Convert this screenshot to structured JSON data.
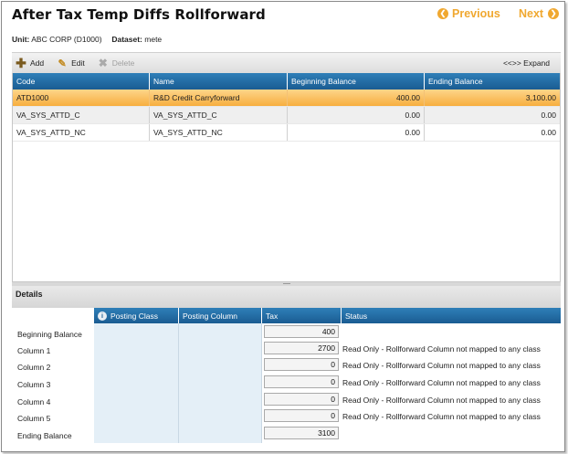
{
  "header": {
    "title": "After Tax Temp Diffs Rollforward",
    "previous_label": "Previous",
    "next_label": "Next"
  },
  "context": {
    "unit_label": "Unit:",
    "unit_value": "ABC CORP (D1000)",
    "dataset_label": "Dataset:",
    "dataset_value": "mete"
  },
  "toolbar": {
    "add_label": "Add",
    "edit_label": "Edit",
    "delete_label": "Delete",
    "expand_label": "<<>> Expand"
  },
  "grid": {
    "columns": [
      "Code",
      "Name",
      "Beginning Balance",
      "Ending Balance"
    ],
    "rows": [
      {
        "code": "ATD1000",
        "name": "R&D Credit Carryforward",
        "beginning": "400.00",
        "ending": "3,100.00"
      },
      {
        "code": "VA_SYS_ATTD_C",
        "name": "VA_SYS_ATTD_C",
        "beginning": "0.00",
        "ending": "0.00"
      },
      {
        "code": "VA_SYS_ATTD_NC",
        "name": "VA_SYS_ATTD_NC",
        "beginning": "0.00",
        "ending": "0.00"
      }
    ]
  },
  "details": {
    "title": "Details",
    "columns": [
      "Posting Class",
      "Posting Column",
      "Tax",
      "Status"
    ],
    "rows": [
      {
        "label": "Beginning Balance",
        "tax": "400",
        "status": ""
      },
      {
        "label": "Column 1",
        "tax": "2700",
        "status": "Read Only - Rollforward Column not mapped to any class"
      },
      {
        "label": "Column 2",
        "tax": "0",
        "status": "Read Only - Rollforward Column not mapped to any class"
      },
      {
        "label": "Column 3",
        "tax": "0",
        "status": "Read Only - Rollforward Column not mapped to any class"
      },
      {
        "label": "Column 4",
        "tax": "0",
        "status": "Read Only - Rollforward Column not mapped to any class"
      },
      {
        "label": "Column 5",
        "tax": "0",
        "status": "Read Only - Rollforward Column not mapped to any class"
      },
      {
        "label": "Ending Balance",
        "tax": "3100",
        "status": ""
      }
    ]
  },
  "colors": {
    "accent": "#f0a830",
    "header_blue": "#1a5c92",
    "selected_row": "#f7ae3f",
    "details_bg": "#e4eff7"
  }
}
